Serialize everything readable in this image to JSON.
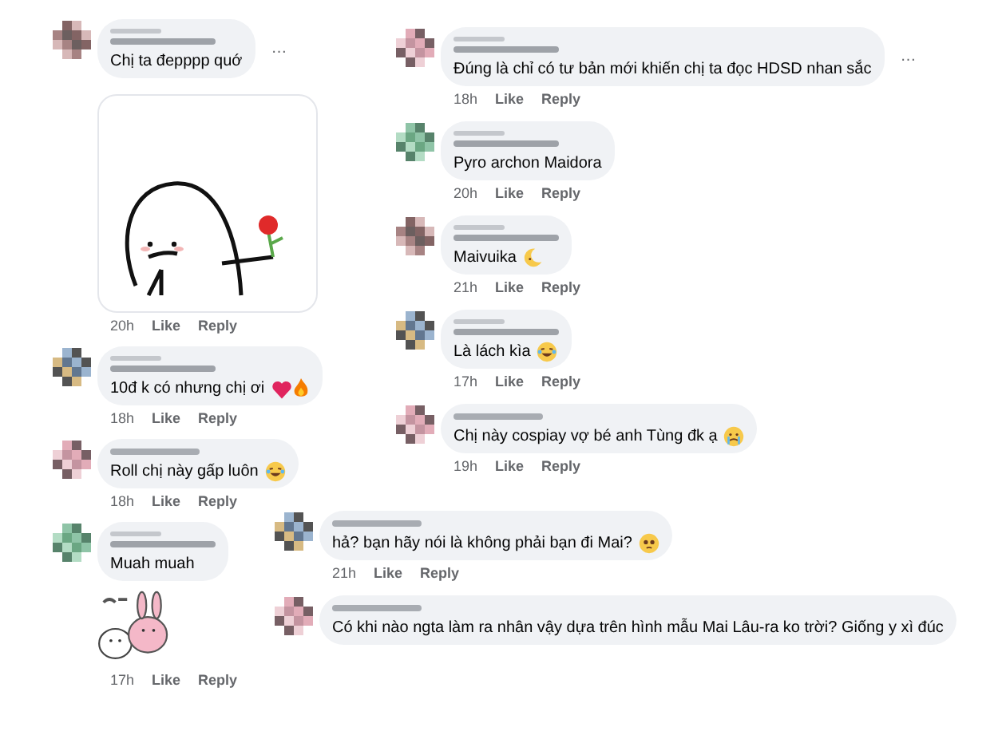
{
  "left_column": [
    {
      "kind": "long-name",
      "text": "Chị ta đepppp quớ",
      "more_button": "…",
      "attachment": {
        "kind": "rose-sticker"
      },
      "meta": {
        "time": "20h",
        "like": "Like",
        "reply": "Reply"
      }
    },
    {
      "kind": "long-name",
      "text": "10đ k có nhưng chị ơi",
      "emojis": [
        {
          "kind": "heart"
        },
        {
          "kind": "fire"
        }
      ],
      "meta": {
        "time": "18h",
        "like": "Like",
        "reply": "Reply"
      }
    },
    {
      "kind": "short-name",
      "text": "Roll chị này gấp luôn",
      "emojis": [
        {
          "kind": "laughing"
        }
      ],
      "meta": {
        "time": "18h",
        "like": "Like",
        "reply": "Reply"
      }
    },
    {
      "kind": "long-name",
      "text": "Muah muah",
      "attachment": {
        "kind": "bunny-sticker"
      },
      "meta": {
        "time": "17h",
        "like": "Like",
        "reply": "Reply"
      }
    }
  ],
  "right_column": [
    {
      "kind": "long-name",
      "text": "Đúng là chỉ có tư bản mới khiến chị ta đọc HDSD nhan sắc",
      "more_button": "…",
      "meta": {
        "time": "18h",
        "like": "Like",
        "reply": "Reply"
      }
    },
    {
      "kind": "long-name",
      "text": "Pyro archon Maidora",
      "meta": {
        "time": "20h",
        "like": "Like",
        "reply": "Reply"
      }
    },
    {
      "kind": "long-name",
      "text": "Maivuika",
      "emojis": [
        {
          "kind": "moon"
        }
      ],
      "meta": {
        "time": "21h",
        "like": "Like",
        "reply": "Reply"
      }
    },
    {
      "kind": "long-name",
      "text": "Là lách kìa",
      "emojis": [
        {
          "kind": "laughing"
        }
      ],
      "meta": {
        "time": "17h",
        "like": "Like",
        "reply": "Reply"
      }
    },
    {
      "kind": "short-name",
      "text": "Chị này cospiay vợ bé anh Tùng đk ạ",
      "emojis": [
        {
          "kind": "crying"
        }
      ],
      "meta": {
        "time": "19h",
        "like": "Like",
        "reply": "Reply"
      }
    }
  ],
  "bottom_column": [
    {
      "kind": "short-name",
      "text": "hả? bạn hãy nói là không phải bạn đi Mai?",
      "emojis": [
        {
          "kind": "pleading"
        }
      ],
      "meta": {
        "time": "21h",
        "like": "Like",
        "reply": "Reply"
      }
    },
    {
      "kind": "short-name",
      "text": "Có khi nào ngta làm ra nhân vậy dựa trên hình mẫu Mai Lâu-ra ko trời? Giống y xì đúc"
    }
  ]
}
